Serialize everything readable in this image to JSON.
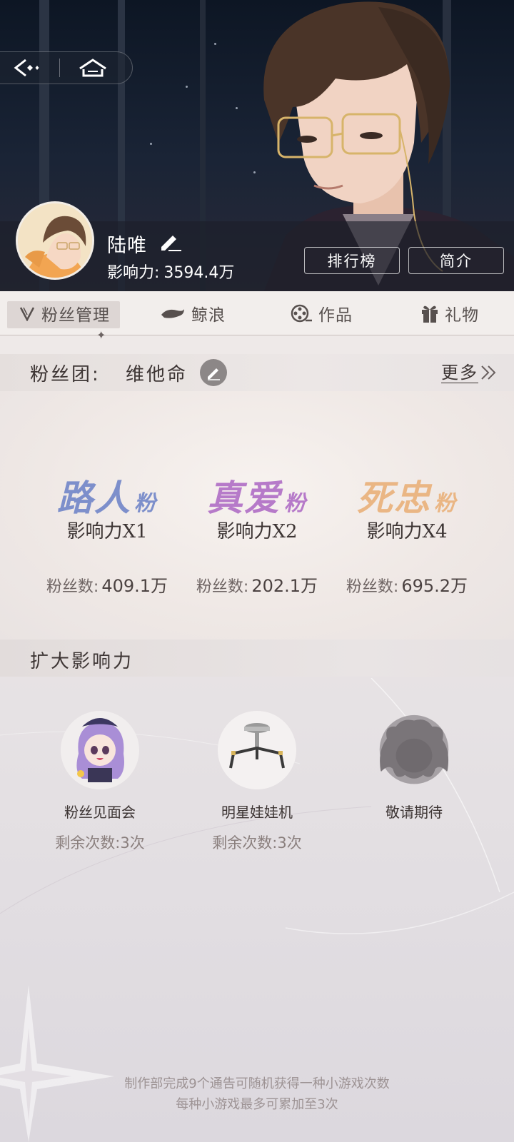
{
  "header": {
    "back_label": "",
    "home_label": ""
  },
  "profile": {
    "name": "陆唯",
    "influence_label": "影响力:",
    "influence_value": "3594.4万",
    "rank_button": "排行榜",
    "intro_button": "简介"
  },
  "tabs": [
    {
      "label": "粉丝管理",
      "icon": "v-icon",
      "active": true
    },
    {
      "label": "鲸浪",
      "icon": "whale-icon",
      "active": false
    },
    {
      "label": "作品",
      "icon": "film-reel-icon",
      "active": false
    },
    {
      "label": "礼物",
      "icon": "gift-icon",
      "active": false
    }
  ],
  "fan_club": {
    "label": "粉丝团:",
    "name": "维他命",
    "more": "更多"
  },
  "fan_tiers": [
    {
      "title": "路人",
      "suffix": "粉",
      "multiplier": "影响力X1",
      "count_label": "粉丝数:",
      "count": "409.1万",
      "color": "#7d8fcb"
    },
    {
      "title": "真爱",
      "suffix": "粉",
      "multiplier": "影响力X2",
      "count_label": "粉丝数:",
      "count": "202.1万",
      "color": "#b67ac9"
    },
    {
      "title": "死忠",
      "suffix": "粉",
      "multiplier": "影响力X4",
      "count_label": "粉丝数:",
      "count": "695.2万",
      "color": "#eab684"
    }
  ],
  "expand": {
    "title": "扩大影响力",
    "games": [
      {
        "name": "粉丝见面会",
        "remaining": "剩余次数:3次"
      },
      {
        "name": "明星娃娃机",
        "remaining": "剩余次数:3次"
      },
      {
        "name": "敬请期待",
        "remaining": ""
      }
    ]
  },
  "footer": {
    "line1": "制作部完成9个通告可随机获得一种小游戏次数",
    "line2": "每种小游戏最多可累加至3次"
  }
}
